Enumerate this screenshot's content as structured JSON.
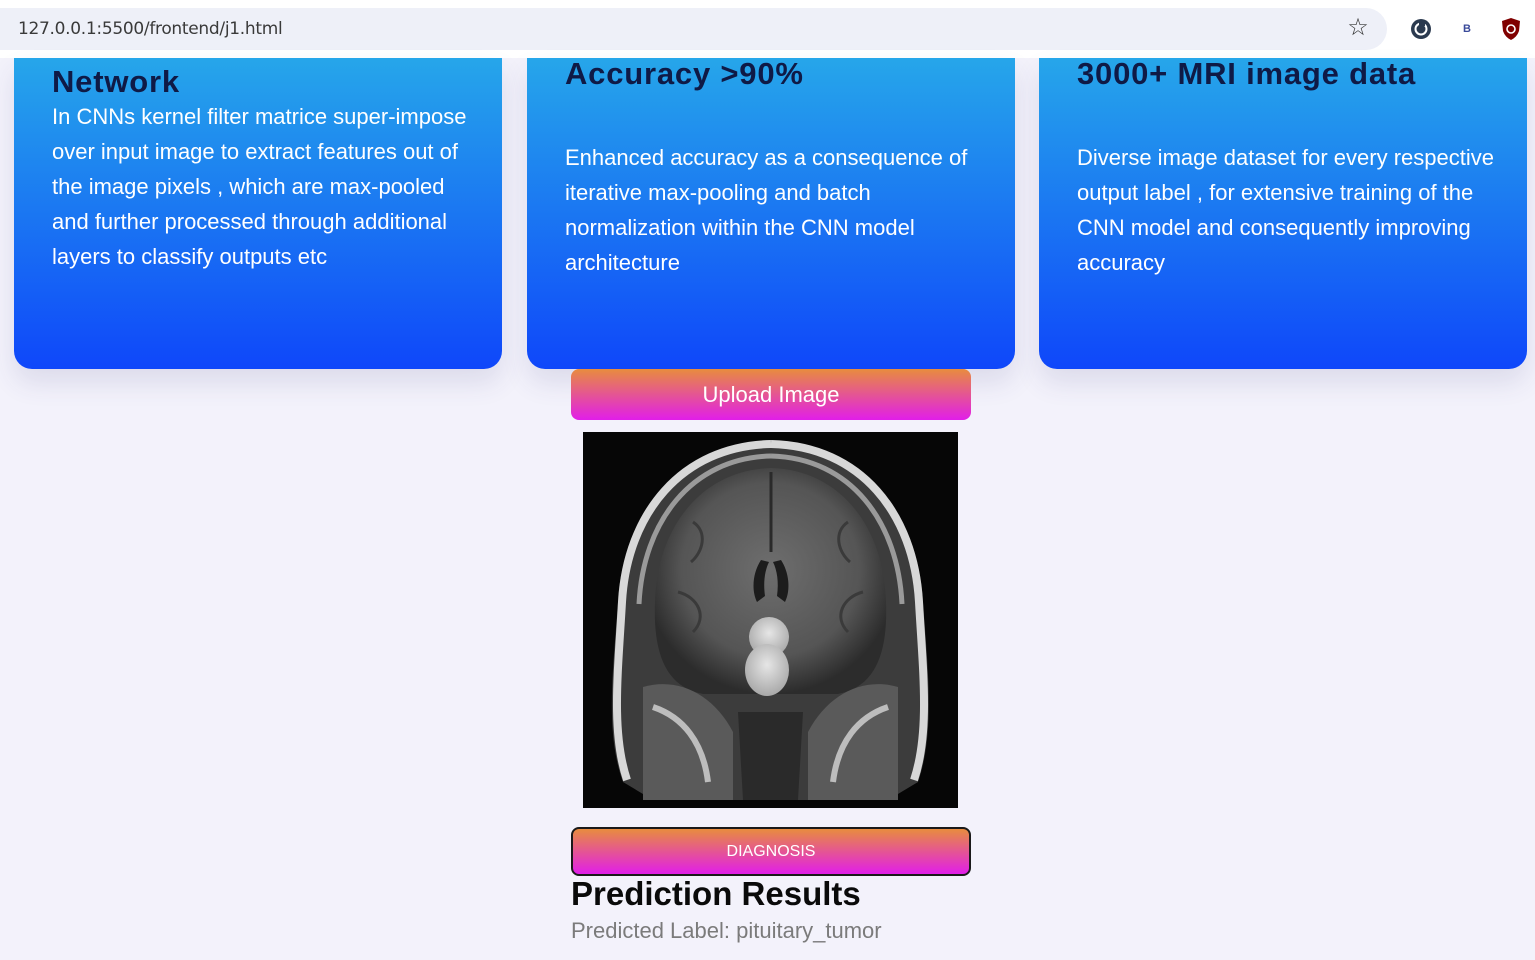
{
  "browser": {
    "url": "127.0.0.1:5500/frontend/j1.html",
    "extension_b_label": "B"
  },
  "cards": [
    {
      "title": "Network",
      "text": "In CNNs kernel filter matrice super-impose over input image to extract features out of the image pixels , which are max-pooled and further processed through additional layers to classify outputs etc"
    },
    {
      "title": "Accuracy >90%",
      "text": "Enhanced accuracy as a consequence of iterative max-pooling and batch normalization within the CNN model architecture"
    },
    {
      "title": "3000+ MRI image data",
      "text": "Diverse image dataset for every respective output label , for extensive training of the CNN model and consequently improving accuracy"
    }
  ],
  "upload": {
    "label": "Upload Image"
  },
  "diagnosis": {
    "label": "DIAGNOSIS"
  },
  "results": {
    "title": "Prediction Results",
    "label": "Predicted Label: pituitary_tumor"
  },
  "colors": {
    "page_bg": "#f3f2fb",
    "card_gradient_top": "#26a6ea",
    "card_gradient_bottom": "#0f47fa",
    "card_title": "#0f1a46",
    "button_gradient_top": "#e88c3e",
    "button_gradient_bottom": "#e11ee9"
  }
}
